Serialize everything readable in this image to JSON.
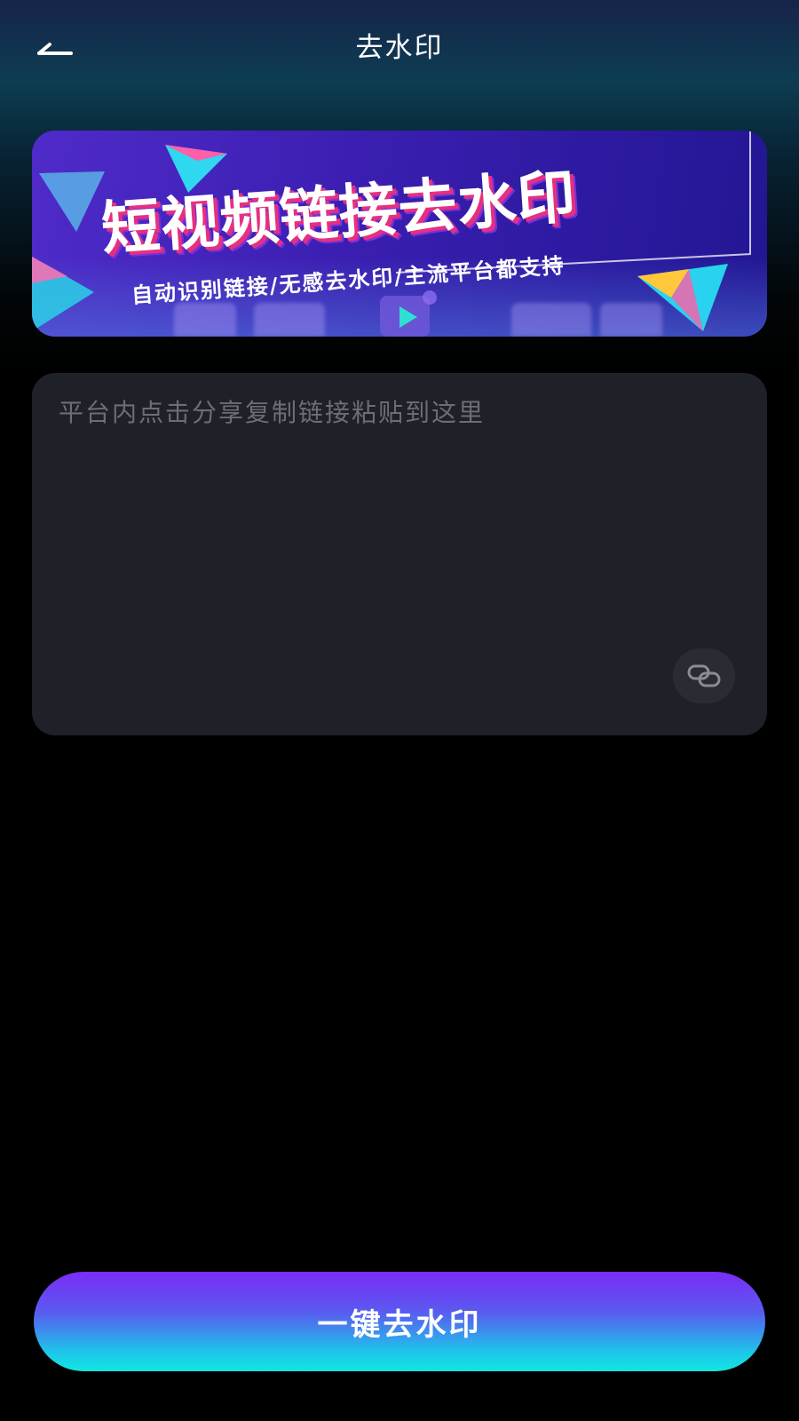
{
  "header": {
    "title": "去水印",
    "back_icon": "back-arrow-icon"
  },
  "banner": {
    "headline": "短视频链接去水印",
    "subtitle": "自动识别链接/无感去水印/主流平台都支持"
  },
  "link_input": {
    "value": "",
    "placeholder": "平台内点击分享复制链接粘贴到这里",
    "paste_icon": "link-icon"
  },
  "action": {
    "label": "一键去水印"
  },
  "colors": {
    "background": "#000000",
    "input_bg": "#1f2128",
    "banner_purple": "#3a1eb0",
    "button_top": "#7a2cf4",
    "button_bottom": "#12e6e0",
    "accent_pink": "#e6307f"
  }
}
